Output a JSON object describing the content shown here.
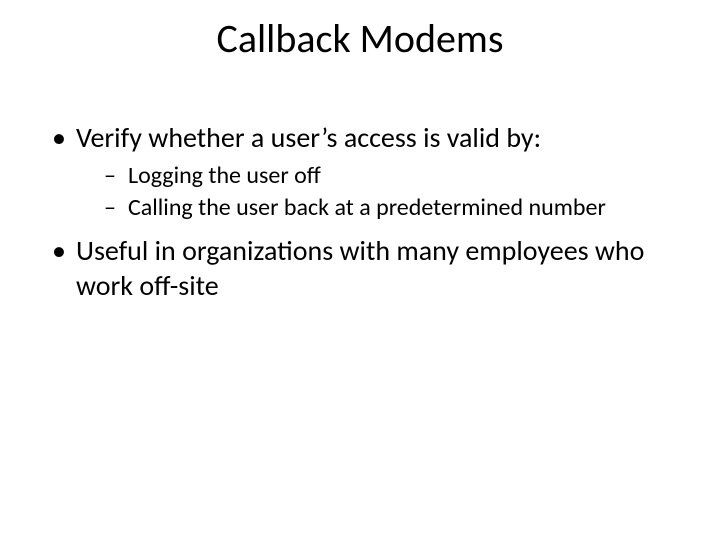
{
  "slide": {
    "title": "Callback Modems",
    "bullets": [
      {
        "text": "Verify whether a user’s access is valid by:",
        "sub": [
          "Logging the user off",
          "Calling the user back at a predetermined number"
        ]
      },
      {
        "text": "Useful in organizations with many employees who work off-site",
        "sub": []
      }
    ]
  }
}
